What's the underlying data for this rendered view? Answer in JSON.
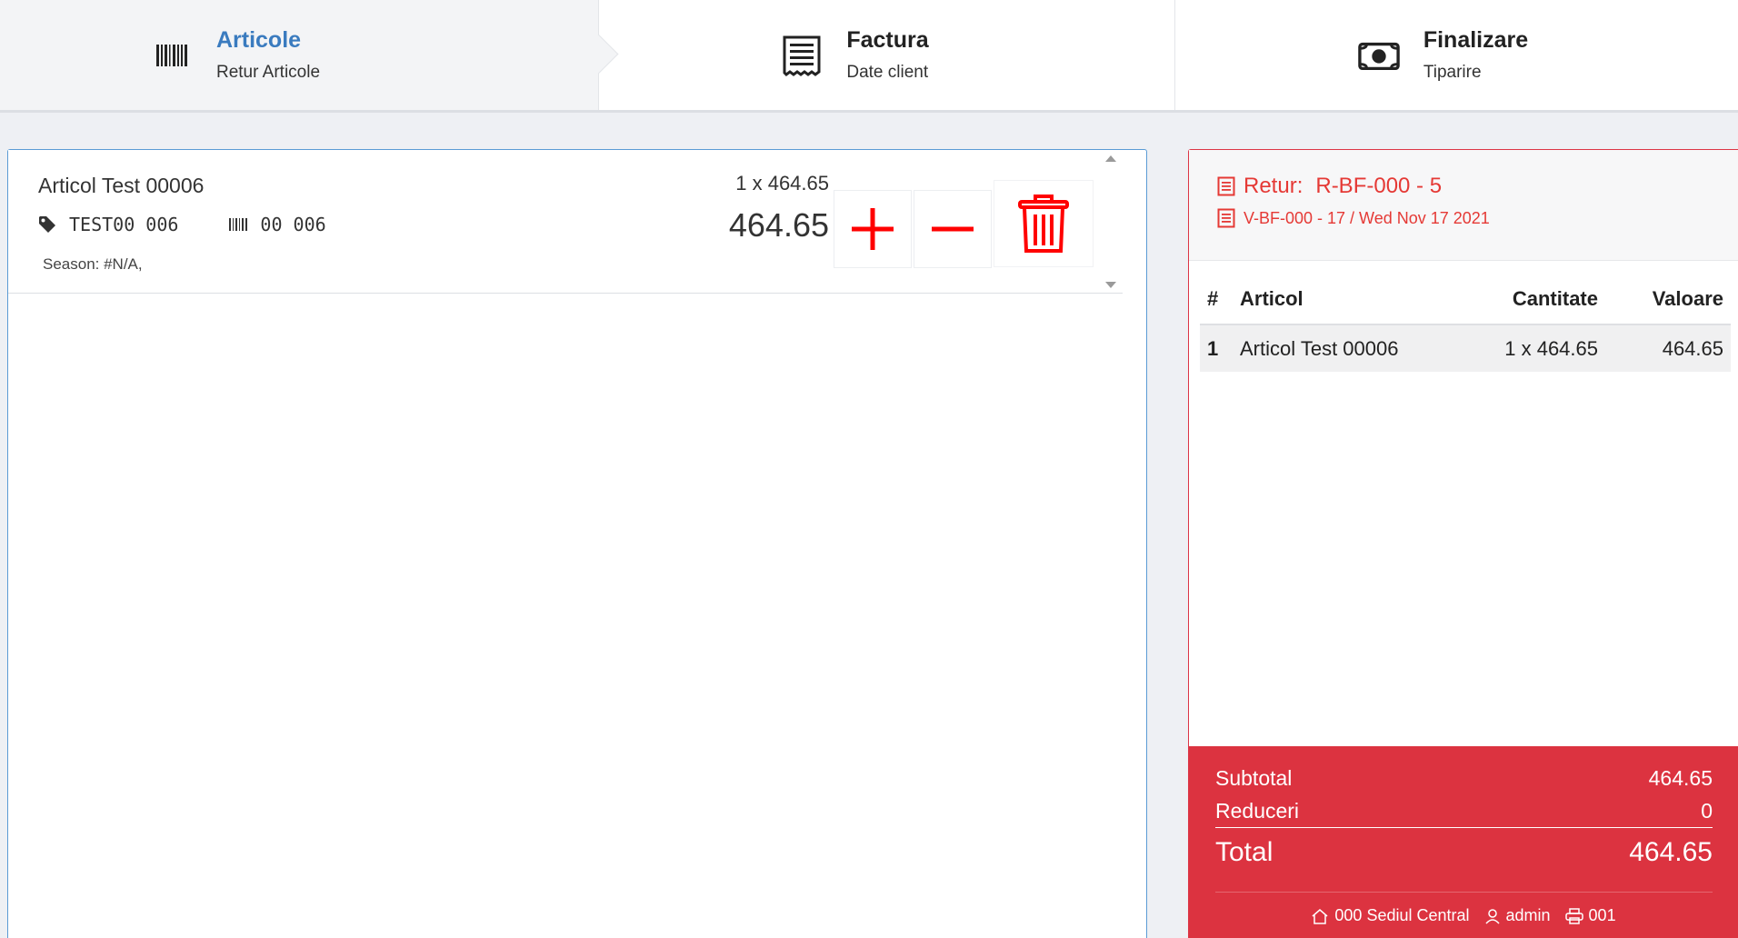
{
  "steps": [
    {
      "title": "Articole",
      "subtitle": "Retur Articole",
      "icon": "barcode-icon"
    },
    {
      "title": "Factura",
      "subtitle": "Date client",
      "icon": "receipt-icon"
    },
    {
      "title": "Finalizare",
      "subtitle": "Tiparire",
      "icon": "money-icon"
    }
  ],
  "item": {
    "name": "Articol Test 00006",
    "sku": "TEST00 006",
    "barcode": "00 006",
    "season": "Season: #N/A,",
    "qty_line": "1 x 464.65",
    "price": "464.65"
  },
  "document": {
    "title_label": "Retur:",
    "title_value": "R-BF-000 - 5",
    "reference": "V-BF-000 - 17 / Wed Nov 17 2021"
  },
  "table": {
    "headers": {
      "num": "#",
      "article": "Articol",
      "qty": "Cantitate",
      "value": "Valoare"
    },
    "rows": [
      {
        "num": "1",
        "article": "Articol Test 00006",
        "qty": "1 x 464.65",
        "value": "464.65"
      }
    ]
  },
  "totals": {
    "subtotal_label": "Subtotal",
    "subtotal": "464.65",
    "discount_label": "Reduceri",
    "discount": "0",
    "total_label": "Total",
    "total": "464.65"
  },
  "footer": {
    "store": "000 Sediul Central",
    "user": "admin",
    "printer": "001"
  },
  "colors": {
    "accent_blue": "#3a7bbf",
    "danger_red": "#dc3340",
    "action_red": "#ff0000"
  }
}
